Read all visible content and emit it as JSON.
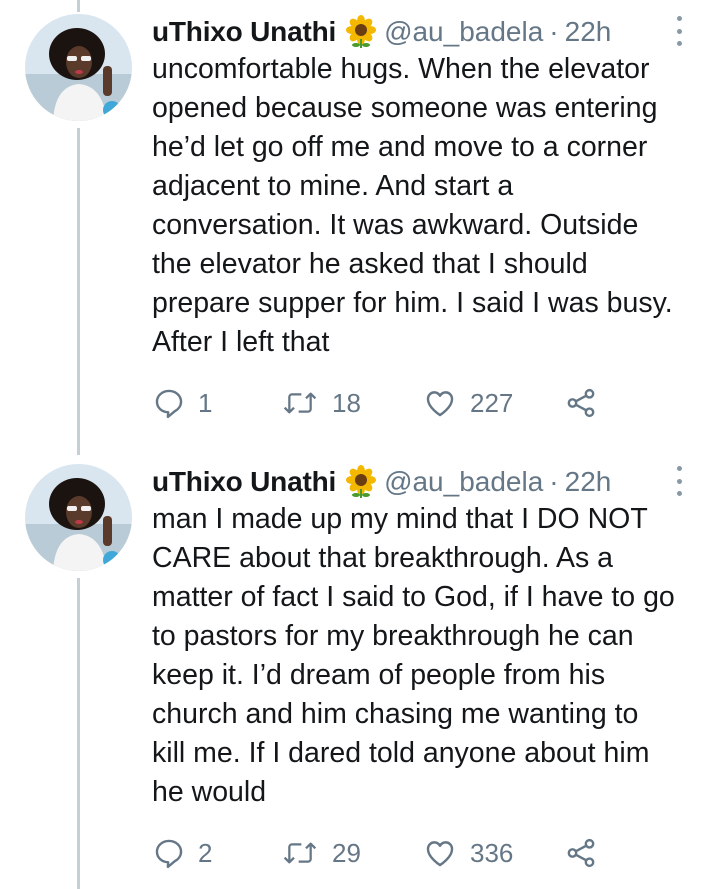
{
  "tweets": [
    {
      "name": "uThixo Unathi",
      "emoji": "sunflower-emoji",
      "handle": "@au_badela",
      "separator": "·",
      "time": "22h",
      "lines": [
        "uncomfortable hugs. When the elevator",
        "opened because someone was entering",
        "he’d let go off me and move to a corner",
        "adjacent to mine. And start a",
        "conversation. It was awkward. Outside",
        "the elevator he asked that I should",
        "prepare supper for him. I said I was busy.",
        "After I left that"
      ],
      "replies": "1",
      "retweets": "18",
      "likes": "227"
    },
    {
      "name": "uThixo Unathi",
      "emoji": "sunflower-emoji",
      "handle": "@au_badela",
      "separator": "·",
      "time": "22h",
      "lines": [
        "man I made up my mind that I DO NOT",
        "CARE about that breakthrough. As a",
        "matter of fact I said to God, if I have to go",
        "to pastors for my breakthrough he can",
        "keep it. I’d dream of people from his",
        "church and him chasing me wanting to",
        "kill me. If I dared told anyone about him",
        "he would"
      ],
      "replies": "2",
      "retweets": "29",
      "likes": "336"
    }
  ],
  "colors": {
    "text": "#14171a",
    "secondary": "#657786",
    "thread_line": "#c4cfd6"
  },
  "icons": [
    "reply-icon",
    "retweet-icon",
    "like-icon",
    "share-icon",
    "more-icon"
  ]
}
